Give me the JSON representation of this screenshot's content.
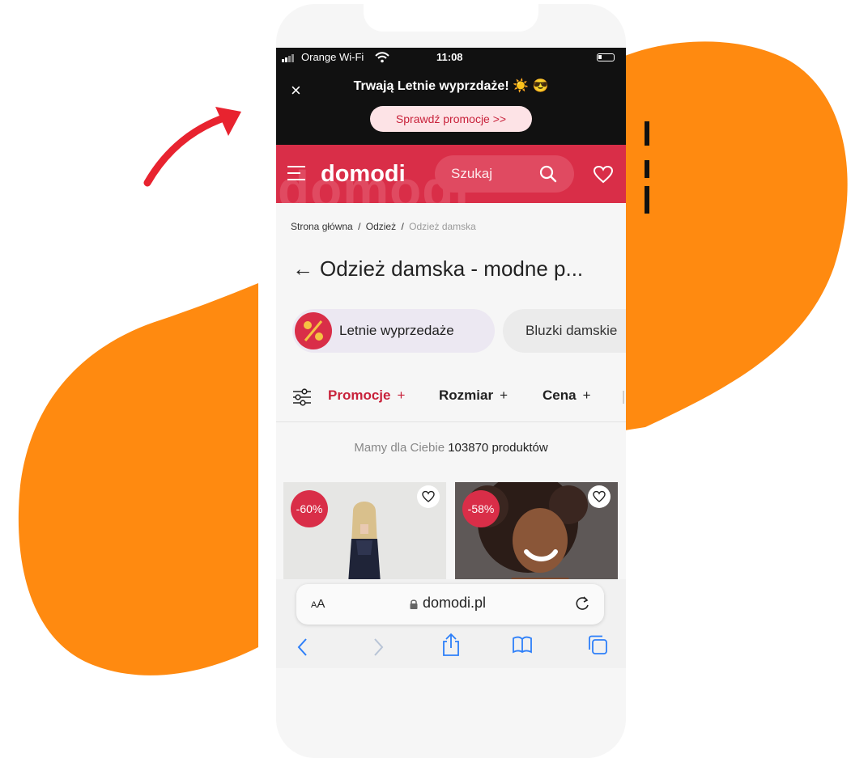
{
  "colors": {
    "brand": "#d92e48",
    "accent_orange": "#ff8a10",
    "promo_bar": "#111111",
    "arrow": "#e8232f"
  },
  "status_bar": {
    "carrier": "Orange Wi-Fi",
    "time": "11:08",
    "icons": [
      "signal-icon",
      "wifi-icon",
      "battery-icon"
    ]
  },
  "promo_banner": {
    "close_label": "×",
    "title": "Trwają Letnie wyprzdaże! ☀️ 😎",
    "button_label": "Sprawdź promocje >>"
  },
  "header": {
    "logo": "domodi",
    "watermark": "domodi",
    "search_placeholder": "Szukaj",
    "icons": [
      "menu-icon",
      "search-icon",
      "heart-icon"
    ]
  },
  "breadcrumb": {
    "items": [
      "Strona główna",
      "Odzież",
      "Odzież damska"
    ],
    "separator": "/"
  },
  "page_title": "Odzież damska - modne p...",
  "categories": [
    {
      "label": "Letnie wyprzedaże",
      "icon": "sale-percent-icon"
    },
    {
      "label": "Bluzki damskie"
    }
  ],
  "filters": {
    "items": [
      {
        "label": "Promocje",
        "active": true
      },
      {
        "label": "Rozmiar",
        "active": false
      },
      {
        "label": "Cena",
        "active": false
      }
    ],
    "plus": "+"
  },
  "results": {
    "prefix": "Mamy dla Ciebie",
    "count": "103870",
    "suffix": "produktów"
  },
  "products": [
    {
      "discount": "-60%",
      "image": "woman-in-dark-dress-photo"
    },
    {
      "discount": "-58%",
      "image": "smiling-woman-curly-hair-photo"
    }
  ],
  "browser": {
    "text_size_label_small": "A",
    "text_size_label_large": "A",
    "domain": "domodi.pl",
    "toolbar": [
      "back-icon",
      "forward-icon",
      "share-icon",
      "bookmarks-icon",
      "tabs-icon"
    ]
  }
}
